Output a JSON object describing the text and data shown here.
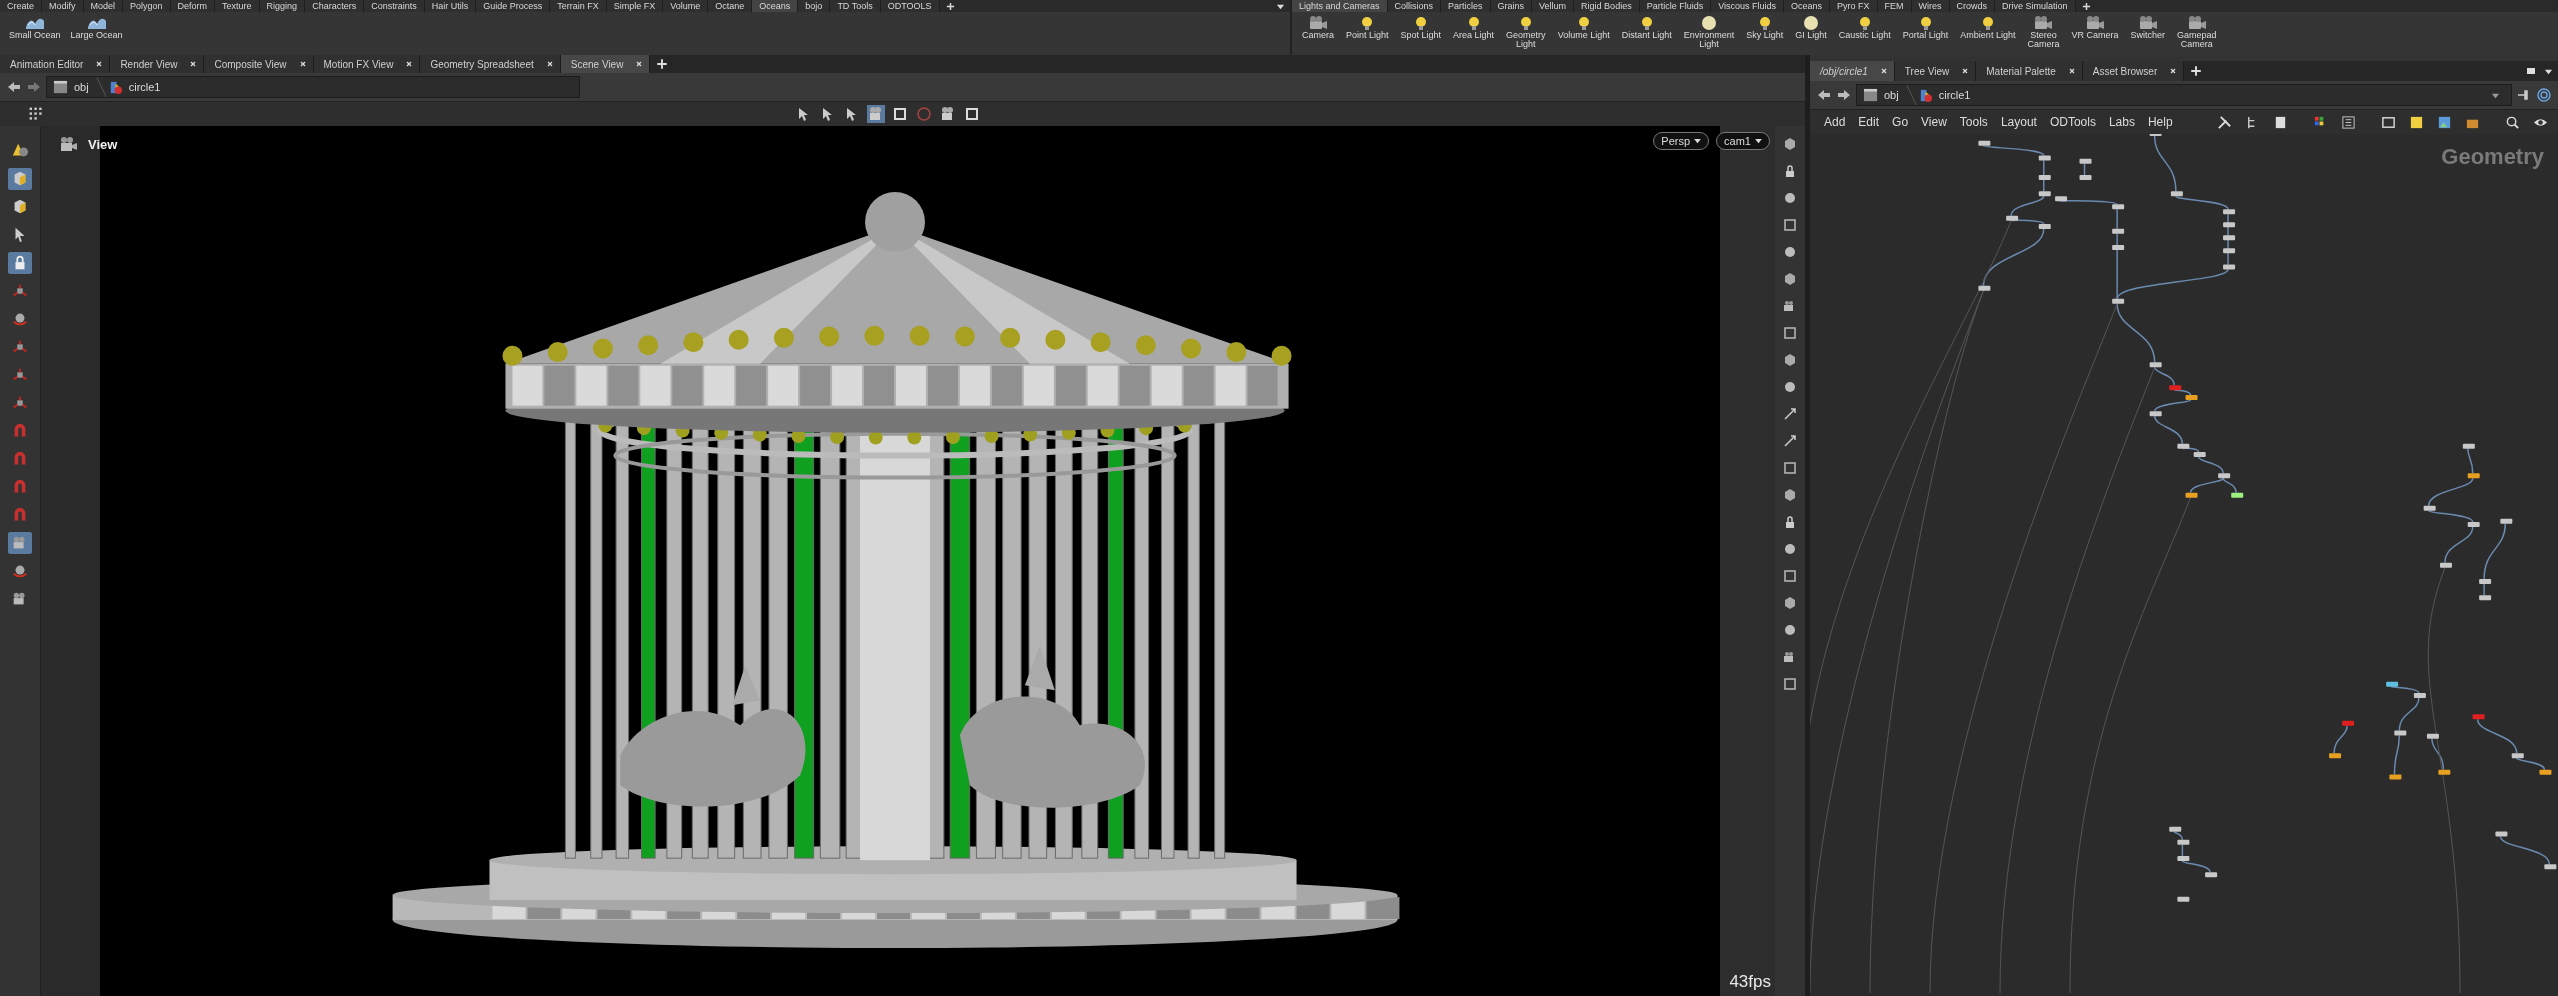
{
  "shelf_left": {
    "tabs": [
      {
        "label": "Create",
        "selected": false
      },
      {
        "label": "Modify",
        "selected": false
      },
      {
        "label": "Model",
        "selected": false
      },
      {
        "label": "Polygon",
        "selected": false
      },
      {
        "label": "Deform",
        "selected": false
      },
      {
        "label": "Texture",
        "selected": false
      },
      {
        "label": "Rigging",
        "selected": false
      },
      {
        "label": "Characters",
        "selected": false
      },
      {
        "label": "Constraints",
        "selected": false
      },
      {
        "label": "Hair Utils",
        "selected": false
      },
      {
        "label": "Guide Process",
        "selected": false
      },
      {
        "label": "Terrain FX",
        "selected": false
      },
      {
        "label": "Simple FX",
        "selected": false
      },
      {
        "label": "Volume",
        "selected": false
      },
      {
        "label": "Octane",
        "selected": false
      },
      {
        "label": "Oceans",
        "selected": true
      },
      {
        "label": "bojo",
        "selected": false
      },
      {
        "label": "TD Tools",
        "selected": false
      },
      {
        "label": "ODTOOLS",
        "selected": false
      }
    ],
    "tools": [
      {
        "label": "Small Ocean"
      },
      {
        "label": "Large Ocean"
      }
    ]
  },
  "shelf_right": {
    "tabs": [
      {
        "label": "Lights and Cameras",
        "selected": true
      },
      {
        "label": "Collisions",
        "selected": false
      },
      {
        "label": "Particles",
        "selected": false
      },
      {
        "label": "Grains",
        "selected": false
      },
      {
        "label": "Vellum",
        "selected": false
      },
      {
        "label": "Rigid Bodies",
        "selected": false
      },
      {
        "label": "Particle Fluids",
        "selected": false
      },
      {
        "label": "Viscous Fluids",
        "selected": false
      },
      {
        "label": "Oceans",
        "selected": false
      },
      {
        "label": "Pyro FX",
        "selected": false
      },
      {
        "label": "FEM",
        "selected": false
      },
      {
        "label": "Wires",
        "selected": false
      },
      {
        "label": "Crowds",
        "selected": false
      },
      {
        "label": "Drive Simulation",
        "selected": false
      }
    ],
    "tools": [
      {
        "label": "Camera"
      },
      {
        "label": "Point Light"
      },
      {
        "label": "Spot Light"
      },
      {
        "label": "Area Light"
      },
      {
        "label": "Geometry\nLight"
      },
      {
        "label": "Volume Light"
      },
      {
        "label": "Distant Light"
      },
      {
        "label": "Environment\nLight"
      },
      {
        "label": "Sky Light"
      },
      {
        "label": "GI Light"
      },
      {
        "label": "Caustic Light"
      },
      {
        "label": "Portal Light"
      },
      {
        "label": "Ambient Light"
      },
      {
        "label": "Stereo\nCamera"
      },
      {
        "label": "VR Camera"
      },
      {
        "label": "Switcher"
      },
      {
        "label": "Gamepad\nCamera"
      }
    ]
  },
  "viewer_pane": {
    "tabs": [
      {
        "label": "Animation Editor",
        "selected": false
      },
      {
        "label": "Render View",
        "selected": false
      },
      {
        "label": "Composite View",
        "selected": false
      },
      {
        "label": "Motion FX View",
        "selected": false
      },
      {
        "label": "Geometry Spreadsheet",
        "selected": false
      },
      {
        "label": "Scene View",
        "selected": true
      }
    ],
    "path": [
      "obj",
      "circle1"
    ],
    "view_tools": [
      {
        "active": false
      },
      {
        "active": false
      },
      {
        "active": false
      },
      {
        "active": true
      },
      {
        "active": false
      },
      {
        "active": false
      },
      {
        "active": false
      },
      {
        "active": false
      }
    ],
    "left_toolbar": [
      {
        "active": false
      },
      {
        "active": true
      },
      {
        "active": false
      },
      {
        "active": false
      },
      {
        "active": true
      },
      {
        "active": false
      },
      {
        "active": false
      },
      {
        "active": false
      },
      {
        "active": false
      },
      {
        "active": false
      },
      {
        "active": false
      },
      {
        "active": false
      },
      {
        "active": false
      },
      {
        "active": false
      },
      {
        "active": true
      },
      {
        "active": false
      },
      {
        "active": false
      }
    ],
    "viewport": {
      "title": "View",
      "view_menu": "Persp",
      "camera_menu": "cam1",
      "fps": "43fps"
    }
  },
  "network_pane": {
    "tabs": [
      {
        "label": "/obj/circle1",
        "selected": true
      },
      {
        "label": "Tree View",
        "selected": false
      },
      {
        "label": "Material Palette",
        "selected": false
      },
      {
        "label": "Asset Browser",
        "selected": false
      }
    ],
    "path": [
      "obj",
      "circle1"
    ],
    "menu": [
      "Add",
      "Edit",
      "Go",
      "View",
      "Tools",
      "Layout",
      "ODTools",
      "Labs",
      "Help"
    ],
    "context_label": "Geometry"
  }
}
